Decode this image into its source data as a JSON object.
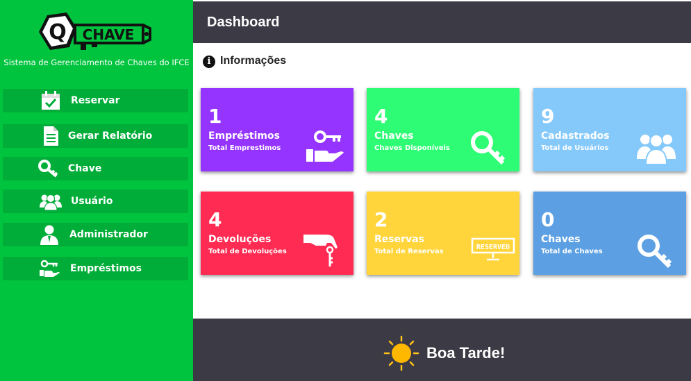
{
  "app": {
    "logo_letter": "Q",
    "logo_word": "CHAVE",
    "system_title": "Sistema de Gerenciamento de Chaves do IFCE"
  },
  "sidebar": {
    "items": [
      {
        "label": "Reservar",
        "icon": "calendar-check-icon"
      },
      {
        "label": "Gerar Relatório",
        "icon": "document-icon"
      },
      {
        "label": "Chave",
        "icon": "key-icon"
      },
      {
        "label": "Usuário",
        "icon": "users-icon"
      },
      {
        "label": "Administrador",
        "icon": "admin-icon"
      },
      {
        "label": "Empréstimos",
        "icon": "key-in-hand-icon"
      }
    ]
  },
  "header": {
    "title": "Dashboard"
  },
  "info": {
    "title": "Informações",
    "icon": "info-icon"
  },
  "cards": [
    {
      "value": "1",
      "label": "Empréstimos",
      "sublabel": "Total Emprestimos",
      "color": "#9533ff",
      "icon": "key-in-hand-icon"
    },
    {
      "value": "4",
      "label": "Chaves",
      "sublabel": "Chaves Disponíveis",
      "color": "#2efc74",
      "icon": "key-icon"
    },
    {
      "value": "9",
      "label": "Cadastrados",
      "sublabel": "Total de Usuários",
      "color": "#85c9fb",
      "icon": "users-icon"
    },
    {
      "value": "4",
      "label": "Devoluções",
      "sublabel": "Total de Devoluções",
      "color": "#ff2b52",
      "icon": "hand-key-icon"
    },
    {
      "value": "2",
      "label": "Reservas",
      "sublabel": "Total de Reservas",
      "color": "#ffd53b",
      "icon": "reserved-sign-icon",
      "icon_text": "RESERVED"
    },
    {
      "value": "0",
      "label": "Chaves",
      "sublabel": "Total de Chaves",
      "color": "#5ca0e3",
      "icon": "key-icon"
    }
  ],
  "footer": {
    "greeting": "Boa Tarde!",
    "icon": "sun-icon"
  },
  "colors": {
    "sidebar": "#00c43e",
    "sidebar_item": "#00ad38",
    "header": "#3c3a45",
    "footer": "#3c3a45"
  }
}
